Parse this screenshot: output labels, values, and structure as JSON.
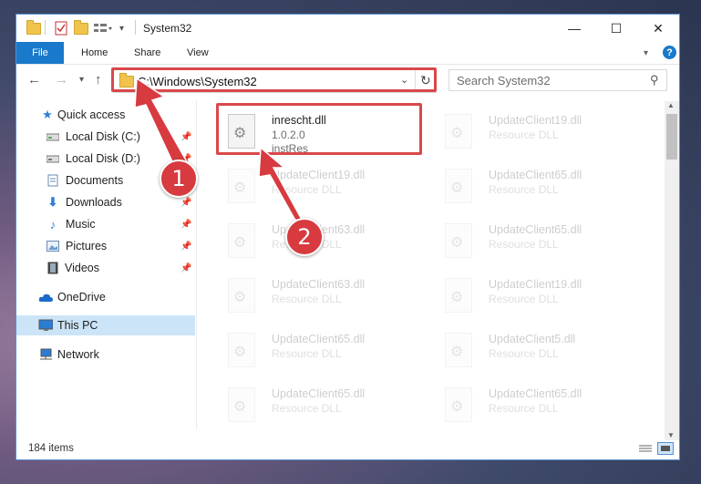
{
  "window": {
    "title": "System32",
    "controls": {
      "minimize": "—",
      "maximize": "☐",
      "close": "✕"
    }
  },
  "ribbon": {
    "tabs": [
      "File",
      "Home",
      "Share",
      "View"
    ],
    "help": "?"
  },
  "address_bar": {
    "path": "C:\\Windows\\System32",
    "search_placeholder": "Search System32"
  },
  "sidebar": {
    "items": [
      {
        "label": "Quick access",
        "icon": "star-icon",
        "pinned": false
      },
      {
        "label": "Local Disk (C:)",
        "icon": "drive-icon",
        "pinned": true
      },
      {
        "label": "Local Disk (D:)",
        "icon": "drive-icon",
        "pinned": true
      },
      {
        "label": "Documents",
        "icon": "documents-icon",
        "pinned": true
      },
      {
        "label": "Downloads",
        "icon": "download-icon",
        "pinned": true
      },
      {
        "label": "Music",
        "icon": "music-icon",
        "pinned": true
      },
      {
        "label": "Pictures",
        "icon": "pictures-icon",
        "pinned": true
      },
      {
        "label": "Videos",
        "icon": "video-icon",
        "pinned": true
      },
      {
        "label": "OneDrive",
        "icon": "cloud-icon",
        "pinned": false
      },
      {
        "label": "This PC",
        "icon": "computer-icon",
        "pinned": false,
        "selected": true
      },
      {
        "label": "Network",
        "icon": "network-icon",
        "pinned": false
      }
    ]
  },
  "files": [
    {
      "name": "inrescht.dll",
      "line2": "1.0.2.0",
      "line3": "instRes",
      "highlighted": true
    },
    {
      "name": "UpdateClient19.dll",
      "line2": "Resource DLL"
    },
    {
      "name": "UpdateClient19.dll",
      "line2": "Resource DLL"
    },
    {
      "name": "UpdateClient65.dll",
      "line2": "Resource DLL"
    },
    {
      "name": "UpdateClient63.dll",
      "line2": "Resource DLL"
    },
    {
      "name": "UpdateClient65.dll",
      "line2": "Resource DLL"
    },
    {
      "name": "UpdateClient63.dll",
      "line2": "Resource DLL"
    },
    {
      "name": "UpdateClient19.dll",
      "line2": "Resource DLL"
    },
    {
      "name": "UpdateClient65.dll",
      "line2": "Resource DLL"
    },
    {
      "name": "UpdateClient5.dll",
      "line2": "Resource DLL"
    },
    {
      "name": "UpdateClient65.dll",
      "line2": "Resource DLL"
    },
    {
      "name": "UpdateClient65.dll",
      "line2": "Resource DLL"
    }
  ],
  "status": {
    "item_count": "184 items"
  },
  "annotations": {
    "step1": "1",
    "step2": "2",
    "color": "#d73a3f"
  }
}
